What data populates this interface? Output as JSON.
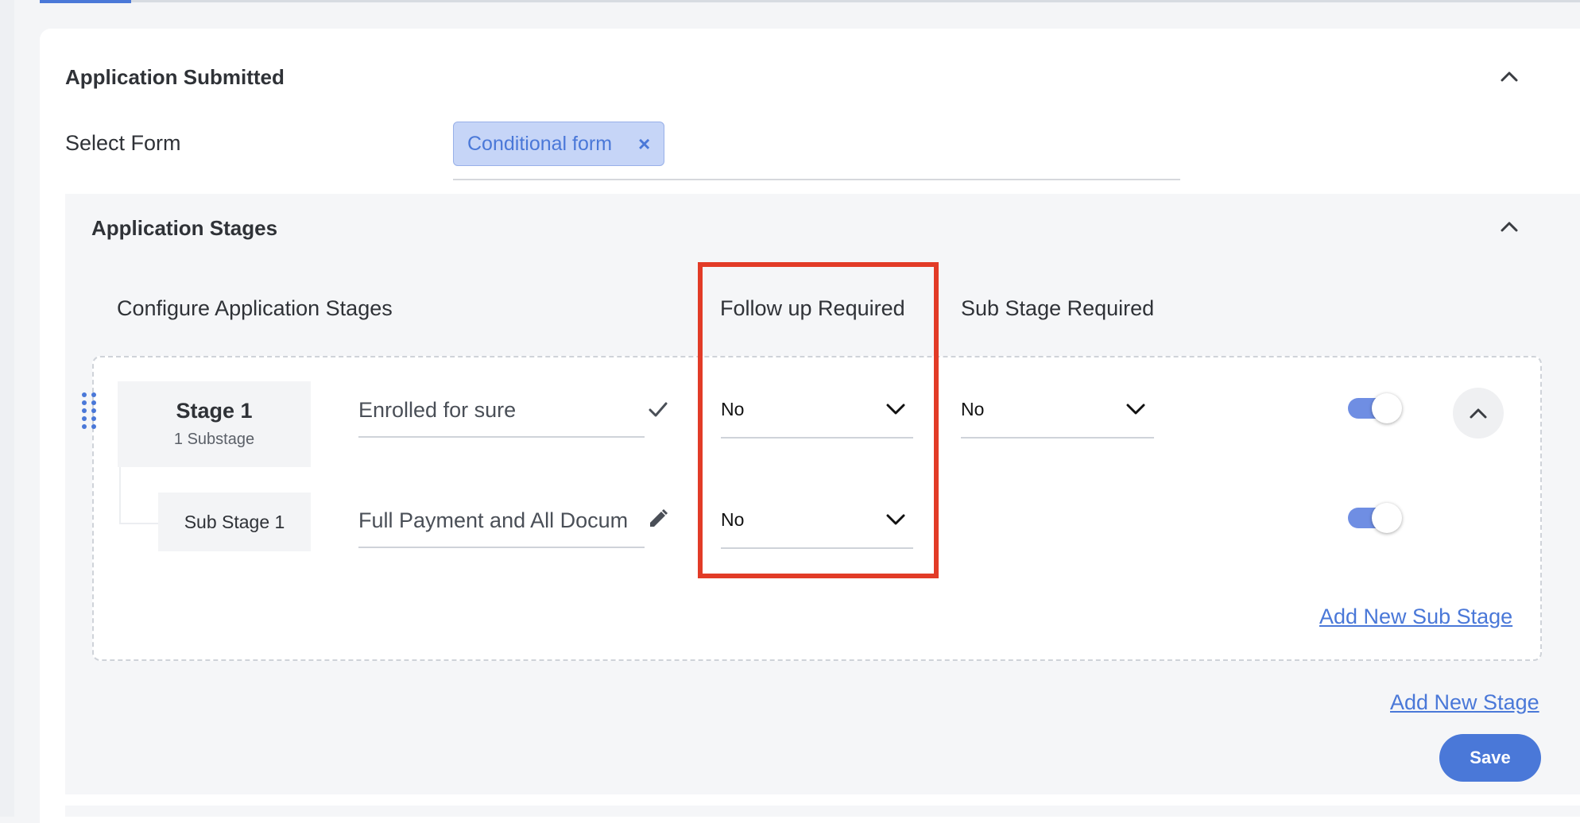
{
  "section": {
    "title": "Application Submitted",
    "select_form_label": "Select Form",
    "chip_label": "Conditional form",
    "chip_remove": "×"
  },
  "stages_panel": {
    "title": "Application Stages",
    "columns": {
      "configure": "Configure Application Stages",
      "follow_up": "Follow up Required",
      "sub_stage": "Sub Stage Required"
    },
    "stage": {
      "title": "Stage 1",
      "subtitle": "1 Substage",
      "name": "Enrolled for sure",
      "follow_up_value": "No",
      "sub_stage_value": "No",
      "enabled": true
    },
    "sub_stage": {
      "title": "Sub Stage 1",
      "name": "Full Payment and All Docum",
      "follow_up_value": "No",
      "enabled": true
    },
    "add_sub_stage": "Add New Sub Stage",
    "add_stage": "Add New Stage",
    "save": "Save"
  },
  "icons": [
    "chevron-up-icon",
    "close-icon",
    "check-icon",
    "pencil-icon",
    "chevron-down-icon",
    "drag-handle-icon"
  ],
  "colors": {
    "accent": "#4a78d8",
    "highlight": "#e23b27",
    "chip_bg": "#c6d5f7",
    "panel_bg": "#f5f6f8"
  }
}
